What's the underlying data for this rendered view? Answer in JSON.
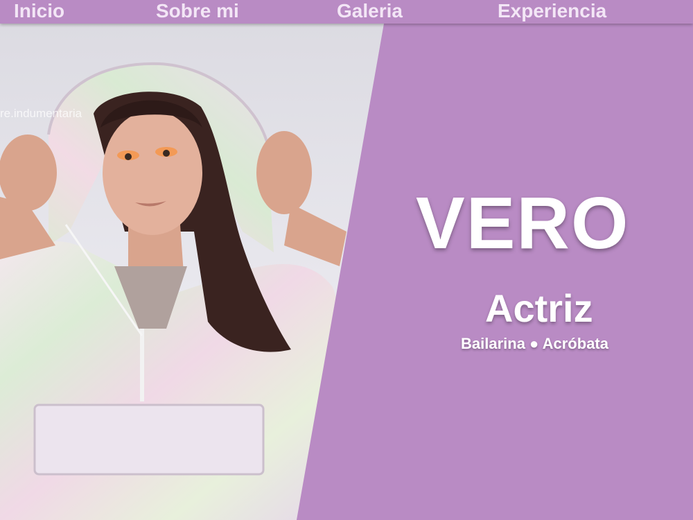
{
  "nav": {
    "items": [
      {
        "label": "Inicio"
      },
      {
        "label": "Sobre mi"
      },
      {
        "label": "Galeria"
      },
      {
        "label": "Experiencia"
      }
    ]
  },
  "hero": {
    "watermark": "re.indumentaria",
    "name": "VERO",
    "role": "Actriz",
    "skills": "Bailarina ● Acróbata"
  },
  "colors": {
    "accent": "#b98bc4",
    "text_light": "#ffffff"
  }
}
